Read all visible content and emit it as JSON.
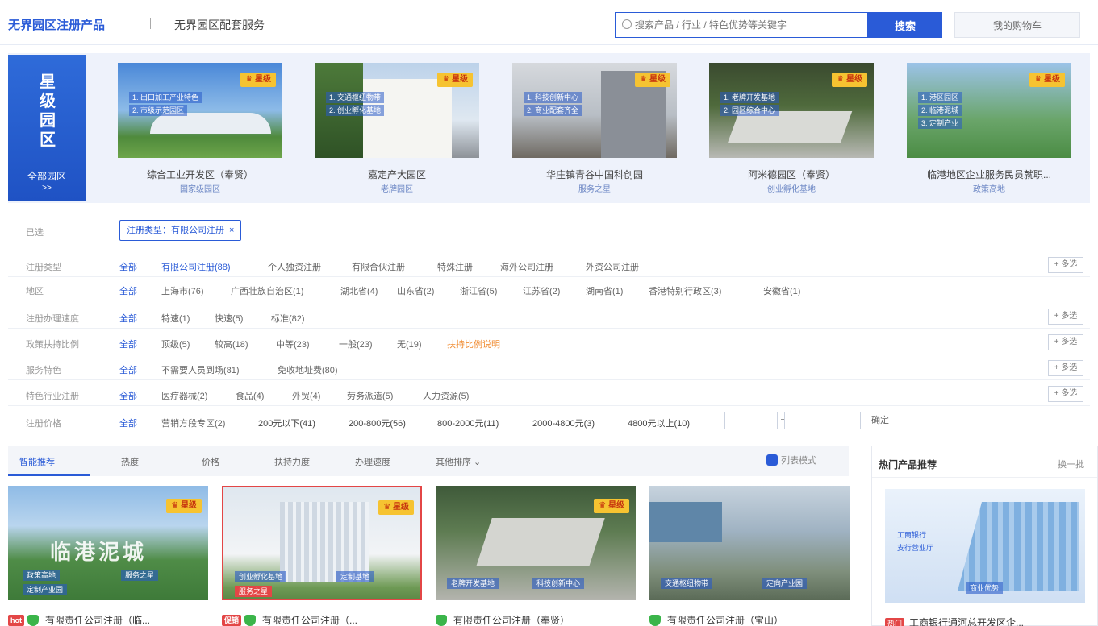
{
  "header": {
    "brand": "无界园区注册产品",
    "brand2": "无界园区配套服务",
    "search_placeholder": "搜索产品 / 行业 / 特色优势等关键字",
    "search_button": "搜索",
    "my_button": "我的购物车"
  },
  "star_parks": {
    "title": "星级园区",
    "all_label": "全部园区",
    "all_arrow": ">>",
    "badge": "♛ 星级",
    "cards": [
      {
        "name": "综合工业开发区（奉贤）",
        "sub": "国家级园区",
        "tags": [
          "1. 出口加工产业特色",
          "2. 市级示范园区"
        ]
      },
      {
        "name": "嘉定产大园区",
        "sub": "老牌园区",
        "tags": [
          "1. 交通枢纽物带",
          "2. 创业孵化基地"
        ]
      },
      {
        "name": "华庄镇青谷中国科创园",
        "sub": "服务之星",
        "tags": [
          "1. 科技创新中心",
          "2. 商业配套齐全"
        ]
      },
      {
        "name": "阿米德园区（奉贤）",
        "sub": "创业孵化基地",
        "tags": [
          "1. 老牌开发基地",
          "2. 园区综合中心"
        ]
      },
      {
        "name": "临港地区企业服务民员就职...",
        "sub": "政策高地",
        "tags": [
          "1. 港区园区",
          "2. 临港泥城",
          "3. 定制产业"
        ]
      }
    ]
  },
  "filters": {
    "selected_label": "已选",
    "selected_chip": "注册类型：有限公司注册",
    "all": "全部",
    "multi": "+ 多选",
    "rows": [
      {
        "label": "注册类型",
        "options": [
          "有限公司注册(88)",
          "个人独资注册",
          "有限合伙注册",
          "特殊注册",
          "海外公司注册",
          "外资公司注册"
        ]
      },
      {
        "label": "地区",
        "options": [
          "上海市(76)",
          "广西壮族自治区(1)",
          "湖北省(4)",
          "山东省(2)",
          "浙江省(5)",
          "江苏省(2)",
          "湖南省(1)",
          "香港特别行政区(3)",
          "安徽省(1)"
        ]
      },
      {
        "label": "注册办理速度",
        "options": [
          "特速(1)",
          "快速(5)",
          "标准(82)"
        ]
      },
      {
        "label": "政策扶持比例",
        "options": [
          "顶级(5)",
          "较高(18)",
          "中等(23)",
          "一般(23)",
          "无(19)",
          "扶持比例说明"
        ]
      },
      {
        "label": "服务特色",
        "options": [
          "不需要人员到场(81)",
          "免收地址费(80)"
        ]
      },
      {
        "label": "特色行业注册",
        "options": [
          "医疗器械(2)",
          "食品(4)",
          "外贸(4)",
          "劳务派遣(5)",
          "人力资源(5)"
        ]
      },
      {
        "label": "注册价格",
        "options": [
          "营销方段专区(2)",
          "200元以下(41)",
          "200-800元(56)",
          "800-2000元(11)",
          "2000-4800元(3)",
          "4800元以上(10)"
        ]
      }
    ],
    "confirm": "确定"
  },
  "sort": {
    "items": [
      "智能推荐",
      "热度",
      "价格",
      "扶持力度",
      "办理速度",
      "其他排序 ⌄"
    ],
    "list_mode": "列表模式"
  },
  "products": [
    {
      "title": "有限责任公司注册（临...",
      "badge": "♛ 星级",
      "hot": "hot",
      "big_text": "临港泥城",
      "img_tags": [
        "政策高地",
        "服务之星",
        "定制产业园"
      ]
    },
    {
      "title": "有限责任公司注册（...",
      "badge": "♛ 星级",
      "hot": "促销",
      "big_text": "",
      "img_tags": [
        "创业孵化基地",
        "服务之星",
        "定制基地"
      ]
    },
    {
      "title": "有限责任公司注册（奉贤）",
      "badge": "♛ 星级",
      "hot": "",
      "big_text": "",
      "img_tags": [
        "老牌开发基地",
        "科技创新中心"
      ]
    },
    {
      "title": "有限责任公司注册（宝山）",
      "badge": "",
      "hot": "",
      "big_text": "",
      "img_tags": [
        "交通枢纽物带",
        "定向产业园"
      ]
    }
  ],
  "hot_ranking": {
    "title": "热门产品推荐",
    "next": "换一批",
    "tag": "热门",
    "product": "工商银行通河总开发区企...",
    "img_labels": [
      "工商银行",
      "支行营业厅",
      "商业优势"
    ]
  },
  "colors": {
    "primary": "#2a5bd7",
    "badge": "#f6c331",
    "hot": "#e34646",
    "green": "#3bb54a"
  }
}
